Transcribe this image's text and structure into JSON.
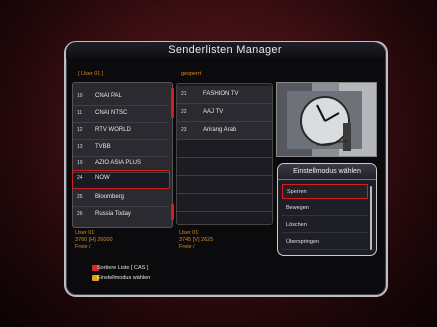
{
  "title": "Senderlisten Manager",
  "left_list_label": "[ User 01 ]",
  "mid_list_label": "gesperrt",
  "left_channels": [
    {
      "num": "10",
      "name": "CNAI PAL"
    },
    {
      "num": "11",
      "name": "CNAI NTSC"
    },
    {
      "num": "12",
      "name": "RTV WORLD"
    },
    {
      "num": "13",
      "name": "TVBB"
    },
    {
      "num": "19",
      "name": "AZIO ASIA PLUS"
    },
    {
      "num": "24",
      "name": "NOW"
    },
    {
      "num": "25",
      "name": "Bloomberg"
    },
    {
      "num": "26",
      "name": "Russia Today"
    }
  ],
  "mid_channels": [
    {
      "num": "21",
      "name": "FASHION TV"
    },
    {
      "num": "22",
      "name": "AAJ TV"
    },
    {
      "num": "23",
      "name": "Arirang Arab"
    },
    {
      "num": "",
      "name": ""
    },
    {
      "num": "",
      "name": ""
    },
    {
      "num": "",
      "name": ""
    },
    {
      "num": "",
      "name": ""
    },
    {
      "num": "",
      "name": ""
    }
  ],
  "mode_menu": {
    "title": "Einstellmodus wählen",
    "items": [
      "Sperren",
      "Bewegen",
      "Löschen",
      "Überspringen"
    ]
  },
  "info_left": {
    "line1": "User 01",
    "line2": "3760 [H] 26000",
    "line3": "Freie /"
  },
  "info_mid": {
    "line1": "User 01",
    "line2": "3745 [V] 2625",
    "line3": "Freie /"
  },
  "legend": [
    {
      "color": "#d42a2a",
      "label": "Sortiere Liste [ CAS ]"
    },
    {
      "color": "#e0a020",
      "label": "Einstellmodus wählen"
    }
  ],
  "colors": {
    "accent": "#d98a1d",
    "selection": "#d41e1e"
  }
}
